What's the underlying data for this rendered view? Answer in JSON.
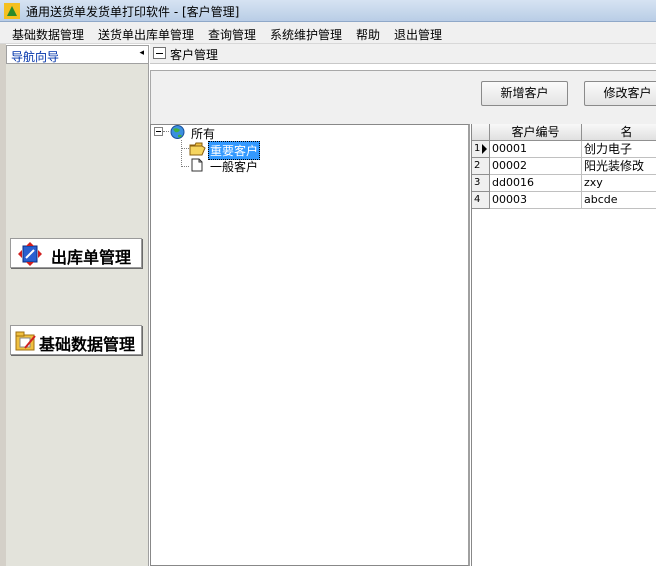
{
  "window": {
    "title": "通用送货单发货单打印软件  - [客户管理]"
  },
  "menu": [
    "基础数据管理",
    "送货单出库单管理",
    "查询管理",
    "系统维护管理",
    "帮助",
    "退出管理"
  ],
  "nav": {
    "title": "导航向导",
    "collapse_glyph": "◂",
    "buttons": [
      "出库单管理",
      "基础数据管理"
    ]
  },
  "content": {
    "title": "客户管理"
  },
  "toolbar": {
    "add_label": "新增客户",
    "edit_label": "修改客户"
  },
  "tree": {
    "root": "所有",
    "children": [
      "重要客户",
      "一般客户"
    ]
  },
  "grid": {
    "columns": [
      "客户编号",
      "名"
    ],
    "rows": [
      {
        "num": "1",
        "code": "00001",
        "name": "创力电子"
      },
      {
        "num": "2",
        "code": "00002",
        "name": "阳光装修改"
      },
      {
        "num": "3",
        "code": "dd0016",
        "name": "zxy"
      },
      {
        "num": "4",
        "code": "00003",
        "name": "abcde"
      }
    ]
  },
  "colors": {
    "nav_title": "#0033aa",
    "selection": "#3399ff",
    "nav_panel": "#e3e3db"
  }
}
